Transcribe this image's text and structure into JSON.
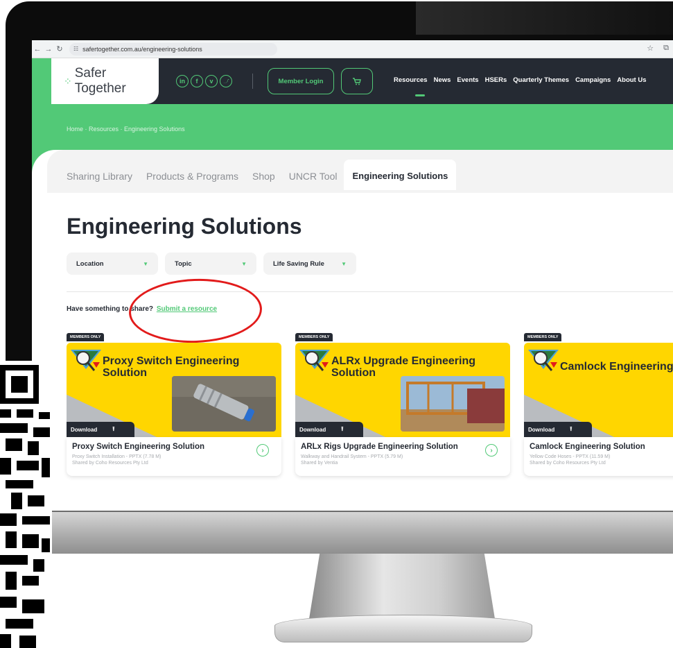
{
  "browser": {
    "url": "safertogether.com.au/engineering-solutions"
  },
  "header": {
    "logo_text": "Safer Together",
    "social": [
      "in",
      "f",
      "v",
      "t"
    ],
    "member_login": "Member Login",
    "nav": [
      "Resources",
      "News",
      "Events",
      "HSERs",
      "Quarterly Themes",
      "Campaigns",
      "About Us"
    ]
  },
  "breadcrumb": "Home · Resources · Engineering Solutions",
  "tabs": [
    "Sharing Library",
    "Products & Programs",
    "Shop",
    "UNCR Tool",
    "Engineering Solutions"
  ],
  "page_title": "Engineering Solutions",
  "filters": [
    "Location",
    "Topic",
    "Life Saving Rule"
  ],
  "share": {
    "prompt": "Have something to share?",
    "link": "Submit a resource"
  },
  "cards": [
    {
      "badge": "MEMBERS ONLY",
      "image_title": "Proxy Switch Engineering Solution",
      "download": "Download",
      "title": "Proxy Switch Engineering Solution",
      "file": "Proxy Switch Installation - PPTX (7.78 M)",
      "shared_by": "Shared by Coho Resources Pty Ltd"
    },
    {
      "badge": "MEMBERS ONLY",
      "image_title": "ALRx Upgrade Engineering Solution",
      "download": "Download",
      "title": "ARLx Rigs Upgrade Engineering Solution",
      "file": "Walkway and Handrail System - PPTX (5.79 M)",
      "shared_by": "Shared by Ventia"
    },
    {
      "badge": "MEMBERS ONLY",
      "image_title": "Camlock Engineering",
      "download": "Download",
      "title": "Camlock Engineering Solution",
      "file": "Yellow Code Hoses - PPTX (11.59 M)",
      "shared_by": "Shared by Coho Resources Pty Ltd"
    }
  ],
  "colors": {
    "brand_green": "#52c977",
    "header_dark": "#252a33",
    "card_yellow": "#ffd600",
    "annotation_red": "#e21b1b"
  }
}
